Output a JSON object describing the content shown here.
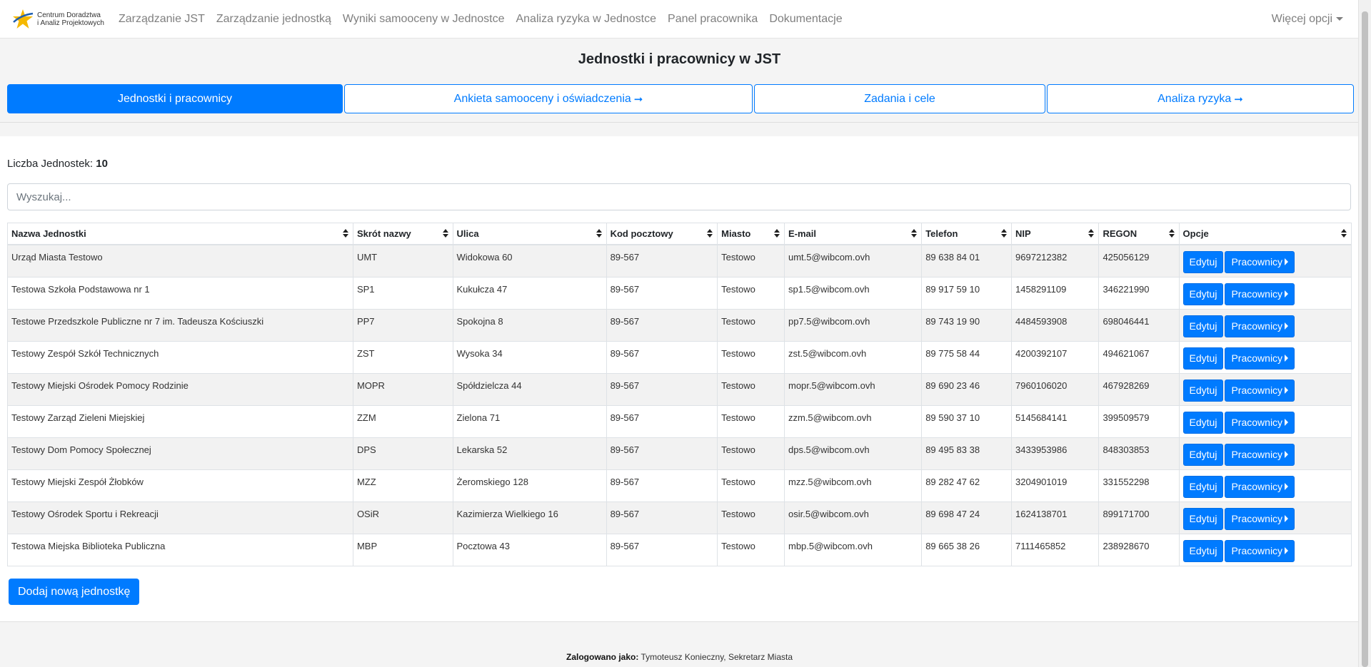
{
  "navbar": {
    "brand_line1": "Centrum Doradztwa",
    "brand_line2": "i Analiz Projektowych",
    "links": [
      "Zarządzanie JST",
      "Zarządzanie jednostką",
      "Wyniki samooceny w Jednostce",
      "Analiza ryzyka w Jednostce",
      "Panel pracownika",
      "Dokumentacje"
    ],
    "more": "Więcej opcji"
  },
  "page_title": "Jednostki i pracownicy w JST",
  "tabs": [
    {
      "label": "Jednostki i pracownicy",
      "arrow": ""
    },
    {
      "label": "Ankieta samooceny i oświadczenia",
      "arrow": "➞"
    },
    {
      "label": "Zadania i cele",
      "arrow": ""
    },
    {
      "label": "Analiza ryzyka",
      "arrow": "➞"
    }
  ],
  "count": {
    "label": "Liczba Jednostek:",
    "value": "10"
  },
  "search": {
    "placeholder": "Wyszukaj..."
  },
  "table": {
    "headers": [
      "Nazwa Jednostki",
      "Skrót nazwy",
      "Ulica",
      "Kod pocztowy",
      "Miasto",
      "E-mail",
      "Telefon",
      "NIP",
      "REGON",
      "Opcje"
    ],
    "rows": [
      [
        "Urząd Miasta Testowo",
        "UMT",
        "Widokowa 60",
        "89-567",
        "Testowo",
        "umt.5@wibcom.ovh",
        "89 638 84 01",
        "9697212382",
        "425056129"
      ],
      [
        "Testowa Szkoła Podstawowa nr 1",
        "SP1",
        "Kukułcza 47",
        "89-567",
        "Testowo",
        "sp1.5@wibcom.ovh",
        "89 917 59 10",
        "1458291109",
        "346221990"
      ],
      [
        "Testowe Przedszkole Publiczne nr 7 im. Tadeusza Kościuszki",
        "PP7",
        "Spokojna 8",
        "89-567",
        "Testowo",
        "pp7.5@wibcom.ovh",
        "89 743 19 90",
        "4484593908",
        "698046441"
      ],
      [
        "Testowy Zespół Szkół Technicznych",
        "ZST",
        "Wysoka 34",
        "89-567",
        "Testowo",
        "zst.5@wibcom.ovh",
        "89 775 58 44",
        "4200392107",
        "494621067"
      ],
      [
        "Testowy Miejski Ośrodek Pomocy Rodzinie",
        "MOPR",
        "Spółdzielcza 44",
        "89-567",
        "Testowo",
        "mopr.5@wibcom.ovh",
        "89 690 23 46",
        "7960106020",
        "467928269"
      ],
      [
        "Testowy Zarząd Zieleni Miejskiej",
        "ZZM",
        "Zielona 71",
        "89-567",
        "Testowo",
        "zzm.5@wibcom.ovh",
        "89 590 37 10",
        "5145684141",
        "399509579"
      ],
      [
        "Testowy Dom Pomocy Społecznej",
        "DPS",
        "Lekarska 52",
        "89-567",
        "Testowo",
        "dps.5@wibcom.ovh",
        "89 495 83 38",
        "3433953986",
        "848303853"
      ],
      [
        "Testowy Miejski Zespół Żłobków",
        "MZZ",
        "Żeromskiego 128",
        "89-567",
        "Testowo",
        "mzz.5@wibcom.ovh",
        "89 282 47 62",
        "3204901019",
        "331552298"
      ],
      [
        "Testowy Ośrodek Sportu i Rekreacji",
        "OSiR",
        "Kazimierza Wielkiego 16",
        "89-567",
        "Testowo",
        "osir.5@wibcom.ovh",
        "89 698 47 24",
        "1624138701",
        "899171700"
      ],
      [
        "Testowa Miejska Biblioteka Publiczna",
        "MBP",
        "Pocztowa 43",
        "89-567",
        "Testowo",
        "mbp.5@wibcom.ovh",
        "89 665 38 26",
        "7111465852",
        "238928670"
      ]
    ],
    "edit_label": "Edytuj",
    "workers_label": "Pracownicy"
  },
  "add_button": "Dodaj nową jednostkę",
  "footer": {
    "label": "Zalogowano jako:",
    "user": "Tymoteusz Konieczny, Sekretarz Miasta"
  },
  "colors": {
    "primary": "#007bff",
    "row_stripe": "#f2f2f2"
  }
}
